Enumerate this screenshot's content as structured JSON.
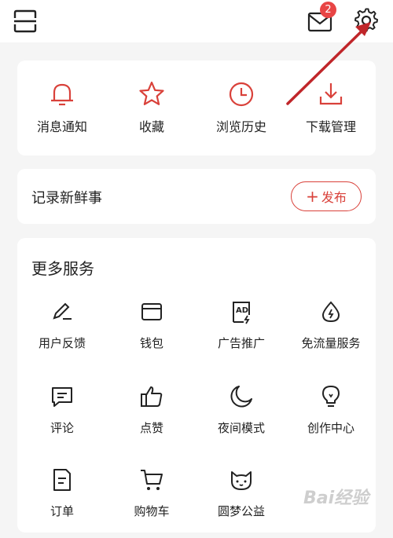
{
  "topbar": {
    "mail_badge_count": "2",
    "icons": [
      "scan-icon",
      "mail-icon",
      "gear-icon"
    ]
  },
  "quick_actions": [
    {
      "label": "消息通知",
      "icon": "bell-icon"
    },
    {
      "label": "收藏",
      "icon": "star-icon"
    },
    {
      "label": "浏览历史",
      "icon": "clock-icon"
    },
    {
      "label": "下载管理",
      "icon": "download-icon"
    }
  ],
  "record": {
    "title": "记录新鲜事",
    "publish_label": "发布"
  },
  "more_services": {
    "title": "更多服务",
    "items": [
      {
        "label": "用户反馈",
        "icon": "feedback-pen-icon"
      },
      {
        "label": "钱包",
        "icon": "wallet-icon"
      },
      {
        "label": "广告推广",
        "icon": "ad-icon"
      },
      {
        "label": "免流量服务",
        "icon": "drop-icon"
      },
      {
        "label": "评论",
        "icon": "comment-icon"
      },
      {
        "label": "点赞",
        "icon": "thumbs-up-icon"
      },
      {
        "label": "夜间模式",
        "icon": "moon-icon"
      },
      {
        "label": "创作中心",
        "icon": "lightbulb-icon"
      },
      {
        "label": "订单",
        "icon": "order-icon"
      },
      {
        "label": "购物车",
        "icon": "cart-icon"
      },
      {
        "label": "圆梦公益",
        "icon": "charity-cat-icon"
      }
    ]
  },
  "colors": {
    "accent": "#d9413a",
    "badge": "#e84545",
    "annotation_arrow": "#c0262a",
    "background": "#f5f5f5"
  },
  "watermark": {
    "text": "Bai经验"
  }
}
